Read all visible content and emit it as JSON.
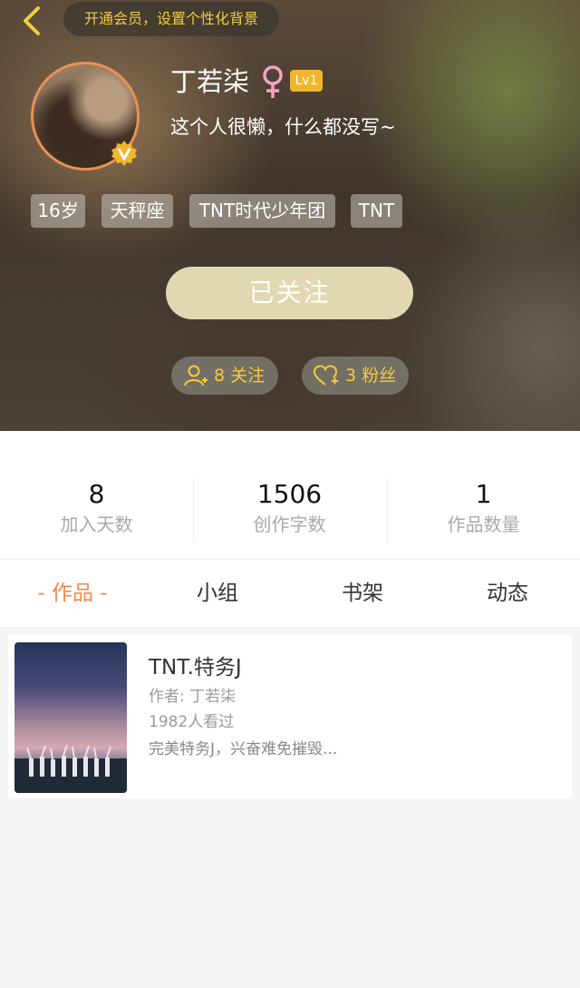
{
  "header": {
    "vip_banner": "开通会员，设置个性化背景",
    "username": "丁若柒",
    "gender_symbol": "♀",
    "level": "Lv1",
    "bio": "这个人很懒，什么都没写~",
    "tags": [
      "16岁",
      "天秤座",
      "TNT时代少年团",
      "TNT"
    ],
    "follow_button": "已关注",
    "following": "8 关注",
    "followers": "3 粉丝",
    "accent_color": "#f4cc3a",
    "gender_color": "#f3a3c6"
  },
  "stats": [
    {
      "value": "8",
      "label": "加入天数"
    },
    {
      "value": "1506",
      "label": "创作字数"
    },
    {
      "value": "1",
      "label": "作品数量"
    }
  ],
  "tabs": [
    {
      "label": "- 作品 -",
      "active": true
    },
    {
      "label": "小组",
      "active": false
    },
    {
      "label": "书架",
      "active": false
    },
    {
      "label": "动态",
      "active": false
    }
  ],
  "works": [
    {
      "title": "TNT.特务J",
      "author": "作者: 丁若柒",
      "views": "1982人看过",
      "description": "完美特务J，兴奋难免摧毁..."
    }
  ]
}
